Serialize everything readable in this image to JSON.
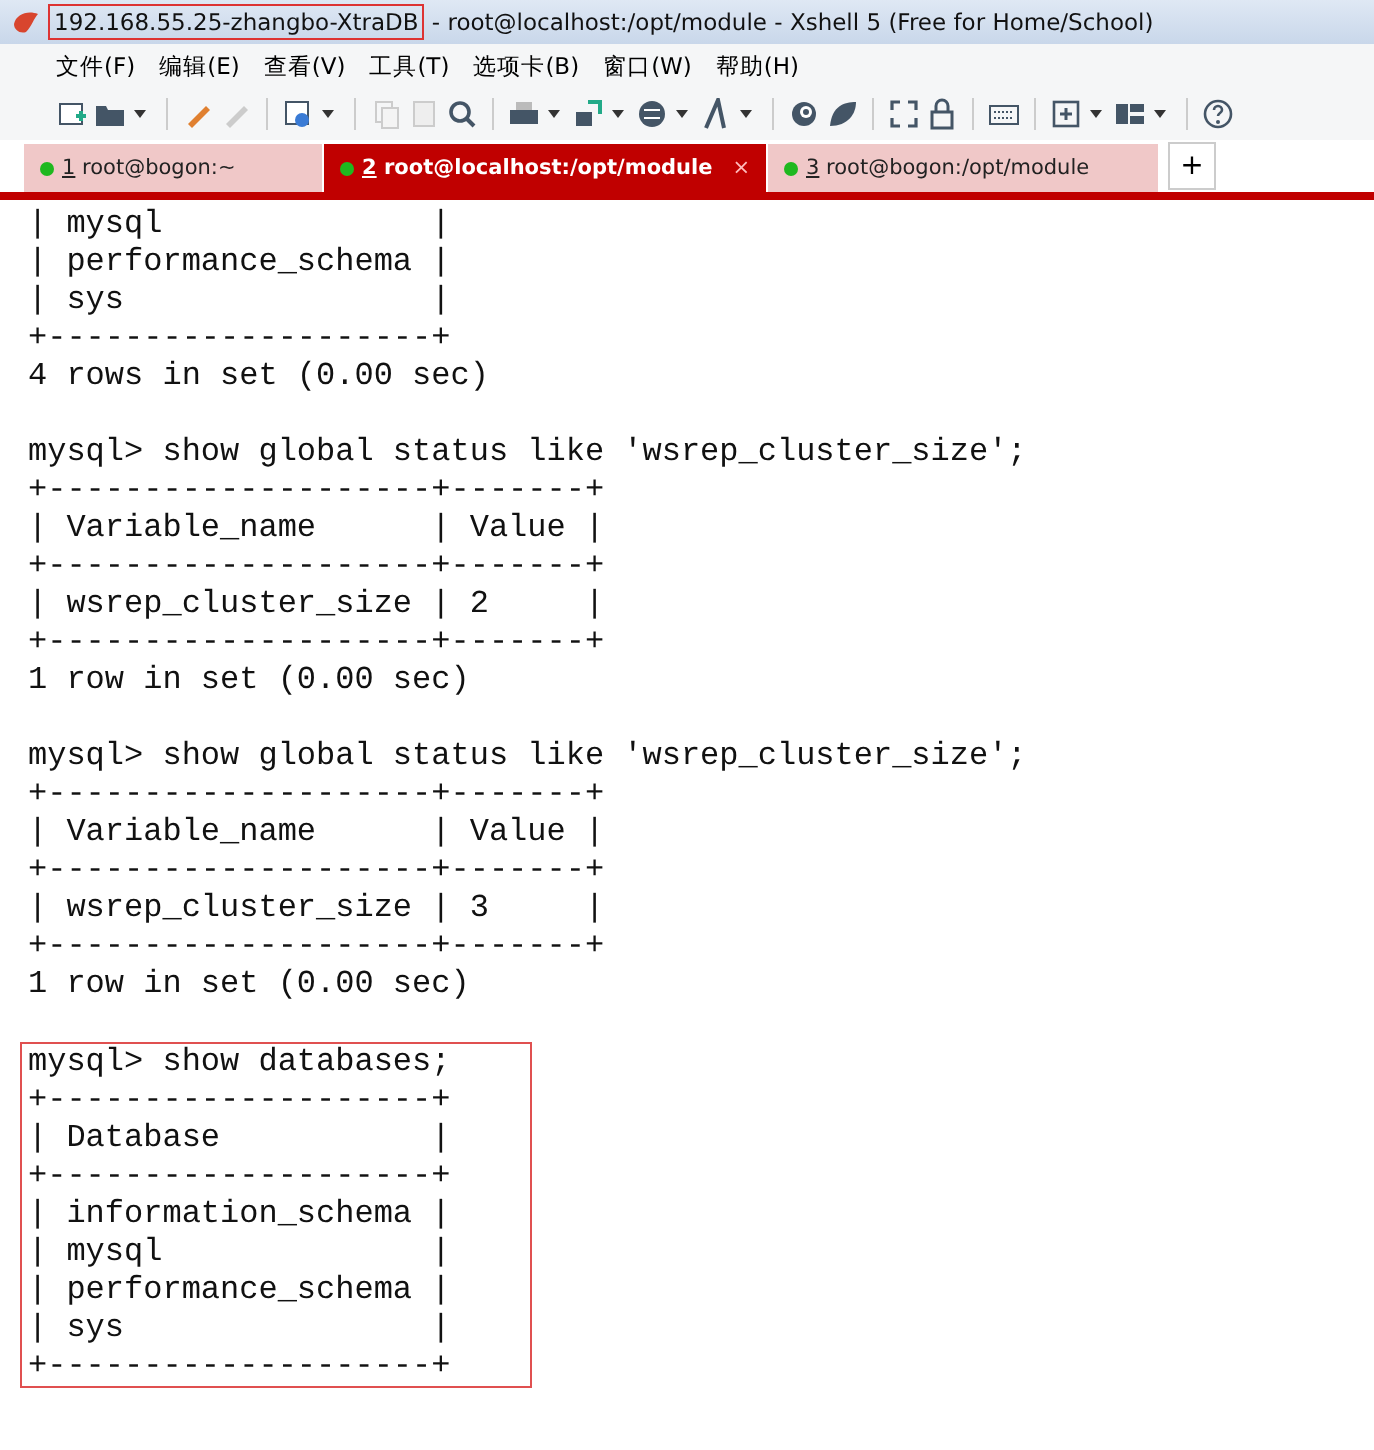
{
  "window": {
    "title_highlighted": "192.168.55.25-zhangbo-XtraDB",
    "title_rest": " - root@localhost:/opt/module - Xshell 5 (Free for Home/School)"
  },
  "menu": [
    "文件(F)",
    "编辑(E)",
    "查看(V)",
    "工具(T)",
    "选项卡(B)",
    "窗口(W)",
    "帮助(H)"
  ],
  "tabs": [
    {
      "number": "1",
      "label": " root@bogon:~",
      "selected": false
    },
    {
      "number": "2",
      "label": " root@localhost:/opt/module",
      "selected": true,
      "close": "×"
    },
    {
      "number": "3",
      "label": " root@bogon:/opt/module",
      "selected": false
    }
  ],
  "new_tab": "+",
  "terminal": [
    {
      "highlighted": false,
      "lines": [
        "| mysql              |",
        "| performance_schema |",
        "| sys                |",
        "+--------------------+",
        "4 rows in set (0.00 sec)"
      ]
    },
    {
      "highlighted": false,
      "lines": [
        "mysql> show global status like 'wsrep_cluster_size';",
        "+--------------------+-------+",
        "| Variable_name      | Value |",
        "+--------------------+-------+",
        "| wsrep_cluster_size | 2     |",
        "+--------------------+-------+",
        "1 row in set (0.00 sec)"
      ]
    },
    {
      "highlighted": false,
      "lines": [
        "mysql> show global status like 'wsrep_cluster_size';",
        "+--------------------+-------+",
        "| Variable_name      | Value |",
        "+--------------------+-------+",
        "| wsrep_cluster_size | 3     |",
        "+--------------------+-------+",
        "1 row in set (0.00 sec)"
      ]
    },
    {
      "highlighted": true,
      "lines": [
        "mysql> show databases;",
        "+--------------------+",
        "| Database           |",
        "+--------------------+",
        "| information_schema |",
        "| mysql              |",
        "| performance_schema |",
        "| sys                |",
        "+--------------------+"
      ]
    }
  ]
}
